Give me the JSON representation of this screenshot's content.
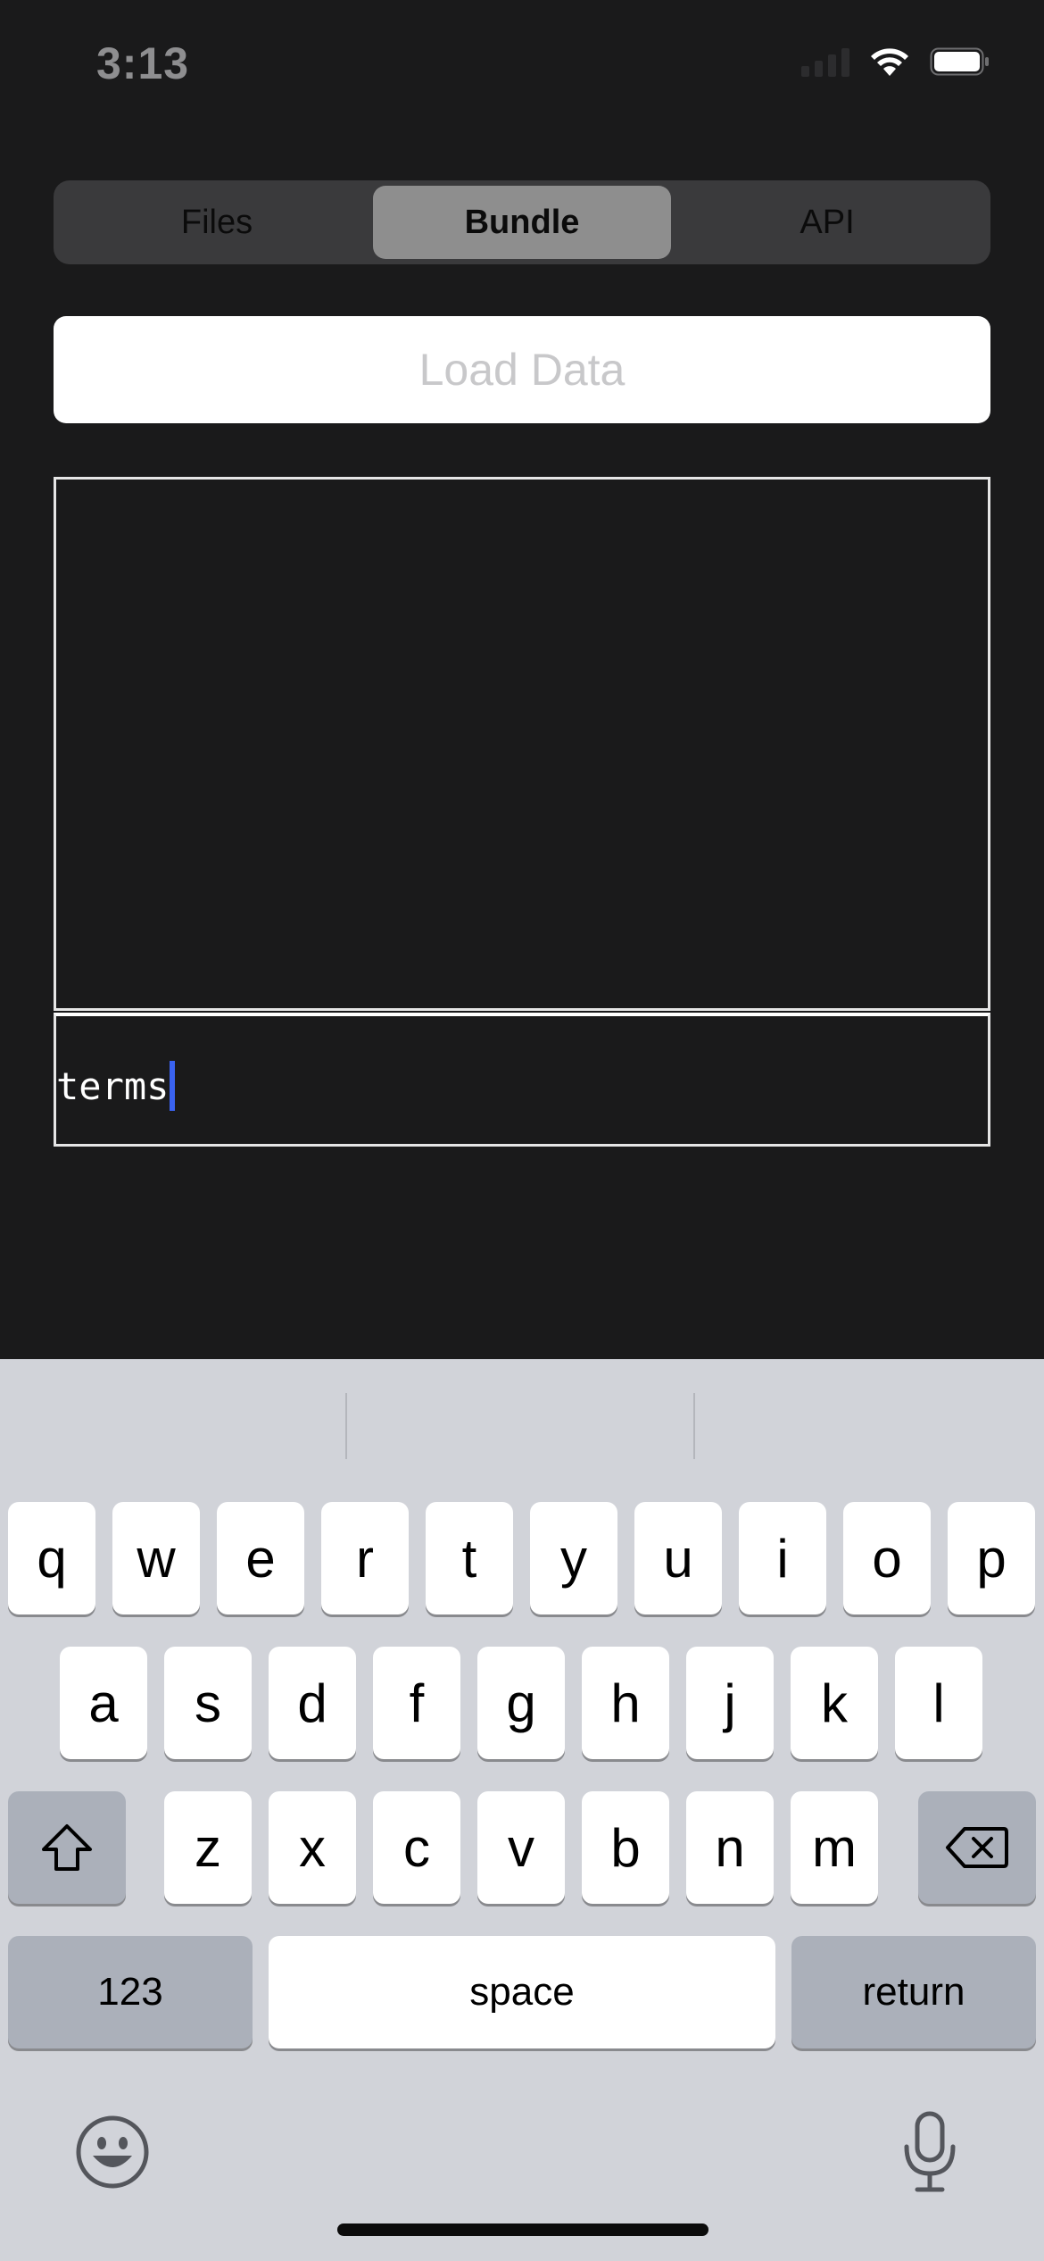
{
  "status_bar": {
    "time": "3:13",
    "icons": [
      "cellular-signal-icon",
      "wifi-icon",
      "battery-icon"
    ]
  },
  "segmented_control": {
    "segments": [
      "Files",
      "Bundle",
      "API"
    ],
    "selected": "Bundle"
  },
  "load_button": {
    "label": "Load Data"
  },
  "input": {
    "value": "terms"
  },
  "keyboard": {
    "row1": [
      "q",
      "w",
      "e",
      "r",
      "t",
      "y",
      "u",
      "i",
      "o",
      "p"
    ],
    "row2": [
      "a",
      "s",
      "d",
      "f",
      "g",
      "h",
      "j",
      "k",
      "l"
    ],
    "row3": [
      "z",
      "x",
      "c",
      "v",
      "b",
      "n",
      "m"
    ],
    "numbers_label": "123",
    "space_label": "space",
    "return_label": "return",
    "icons": [
      "shift-icon",
      "delete-icon",
      "emoji-icon",
      "microphone-icon"
    ]
  },
  "colors": {
    "background": "#1a1a1b",
    "keyboard_background": "#d1d3d9",
    "caret": "#3a63f0",
    "selected_segment": "#8e8e8e"
  }
}
